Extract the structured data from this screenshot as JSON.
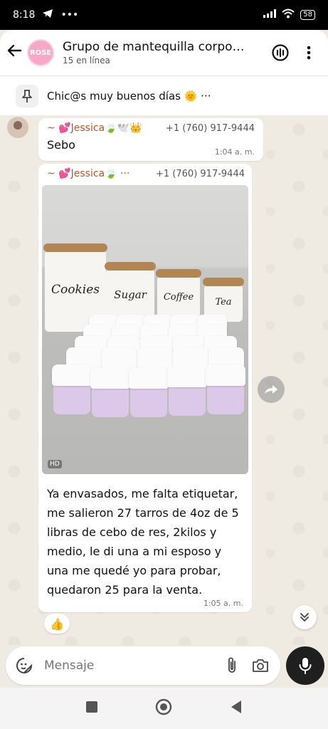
{
  "status_bar": {
    "time": "8:18",
    "battery": "58"
  },
  "header": {
    "avatar_text": "ROSE",
    "title": "Grupo de mantequilla corpo…",
    "subtitle": "15 en línea"
  },
  "pinned": {
    "text": "Chic@s muy buenos días 🌞 ···"
  },
  "messages": [
    {
      "sender": "~ 💕Jessica🍃🕊️👑",
      "phone": "+1 (760) 917-9444",
      "text": "Sebo",
      "time": "1:04 a. m."
    },
    {
      "sender": "~ 💕Jessica🍃 ···",
      "phone": "+1 (760) 917-9444",
      "image": {
        "canister_labels": [
          "Cookies",
          "Sugar",
          "Coffee",
          "Tea"
        ],
        "badge": "HD"
      },
      "text": "Ya envasados, me falta etiquetar, me salieron 27 tarros de 4oz de 5 libras de cebo de res, 2kilos y medio, le di una a mi esposo y una me quedé yo para probar, quedaron 25 para la venta.",
      "time": "1:05 a. m.",
      "reaction": "👍"
    }
  ],
  "composer": {
    "placeholder": "Mensaje"
  },
  "colors": {
    "accent_pink": "#f7a8c8",
    "sender_name": "#c2541f",
    "chat_bg": "#efeae2"
  }
}
